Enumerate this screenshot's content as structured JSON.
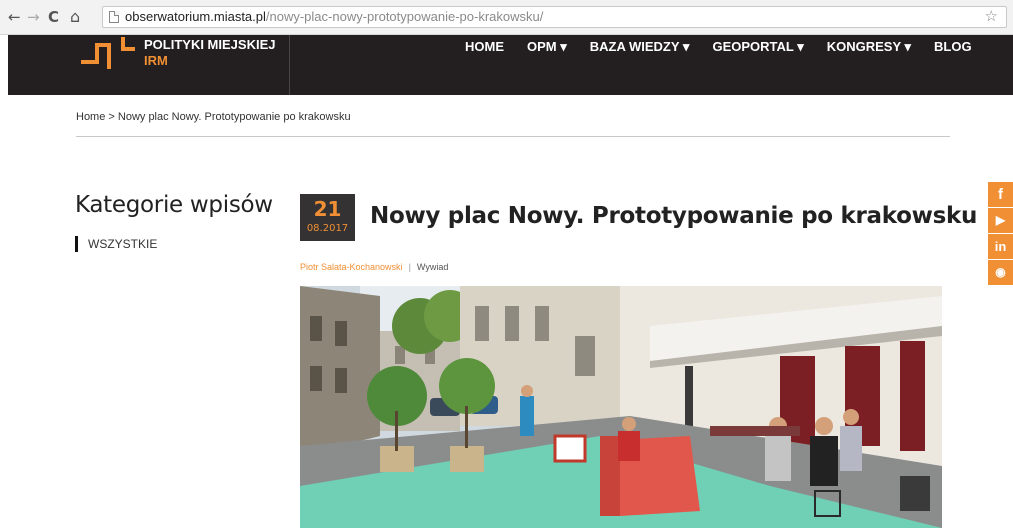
{
  "browser": {
    "back": "←",
    "forward": "→",
    "reload": "C",
    "home": "⌂",
    "url_domain": "obserwatorium.miasta.pl",
    "url_path": "/nowy-plac-nowy-prototypowanie-po-krakowsku/",
    "bookmark": "☆"
  },
  "site": {
    "logo_line1": "POLITYKI MIEJSKIEJ",
    "logo_line2": "IRM",
    "accent_color": "#f08f34",
    "header_color": "#231f20",
    "menu": [
      {
        "label": "HOME"
      },
      {
        "label": "OPM ▾"
      },
      {
        "label": "BAZA WIEDZY ▾"
      },
      {
        "label": "GEOPORTAL ▾"
      },
      {
        "label": "KONGRESY ▾"
      },
      {
        "label": "BLOG"
      }
    ]
  },
  "breadcrumb": "Home > Nowy plac Nowy. Prototypowanie po krakowsku",
  "sidebar": {
    "title": "Kategorie wpisów",
    "items": [
      {
        "label": "WSZYSTKIE"
      }
    ]
  },
  "post": {
    "day": "21",
    "month_year": "08.2017",
    "title": "Nowy plac Nowy. Prototypowanie po krakowsku",
    "author": "Piotr Salata-Kochanowski",
    "separator": "|",
    "category": "Wywiad"
  },
  "social": [
    {
      "icon": "facebook-icon",
      "glyph": "f"
    },
    {
      "icon": "youtube-icon",
      "glyph": "▶"
    },
    {
      "icon": "linkedin-icon",
      "glyph": "in"
    },
    {
      "icon": "rss-icon",
      "glyph": "◉"
    }
  ]
}
